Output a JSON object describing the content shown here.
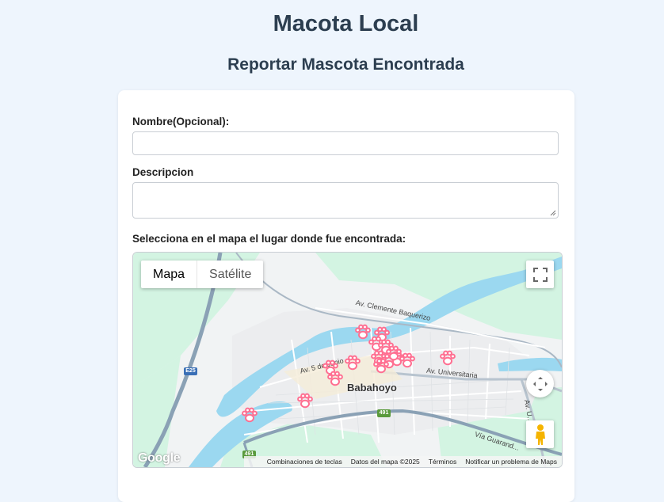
{
  "header": {
    "title": "Macota Local",
    "subtitle": "Reportar Mascota Encontrada"
  },
  "form": {
    "name_label": "Nombre(Opcional):",
    "name_value": "",
    "description_label": "Descripcion",
    "description_value": "",
    "map_label": "Selecciona en el mapa el lugar donde fue encontrada:"
  },
  "map": {
    "type_options": [
      "Mapa",
      "Satélite"
    ],
    "selected_type": "Mapa",
    "city_label": "Babahoyo",
    "street_labels": [
      "Av. Clemente Baquerizo",
      "Av. 5 de Junio",
      "Av. Universitaria",
      "Vía Guarand...",
      "Av. U..."
    ],
    "route_shields": [
      "E25",
      "491",
      "491"
    ],
    "google_logo": "Google",
    "footer": {
      "shortcuts": "Combinaciones de teclas",
      "map_data": "Datos del mapa ©2025",
      "terms": "Términos",
      "report": "Notificar un problema de Maps"
    },
    "icons": {
      "fullscreen": "fullscreen-icon",
      "camera": "camera-control-icon",
      "pegman": "street-view-pegman-icon",
      "marker": "paw-marker-icon"
    },
    "marker_color": "#ff6f91",
    "water_color": "#9bd8f0",
    "park_color": "#d5f5e3"
  }
}
